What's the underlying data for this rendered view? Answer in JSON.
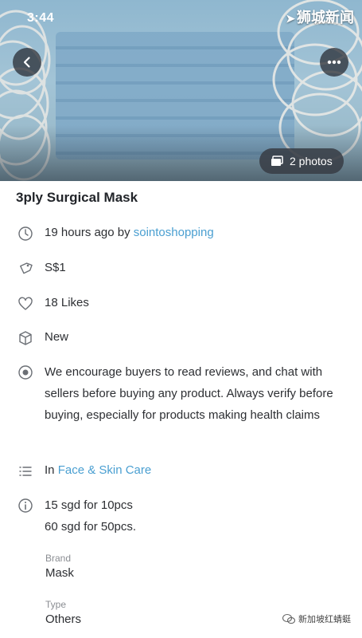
{
  "status_bar": {
    "time": "3:44"
  },
  "watermark_top": "狮城新闻",
  "gallery": {
    "photos_label": "2 photos",
    "back_icon": "back-arrow-icon",
    "more_icon": "more-dots-icon"
  },
  "listing": {
    "title": "3ply Surgical Mask",
    "posted_prefix": "19 hours ago by",
    "seller": "sointoshopping",
    "price": "S$1",
    "likes": "18 Likes",
    "condition": "New",
    "notice": "We encourage buyers to read reviews, and chat with sellers before buying any product. Always verify before buying, especially for products making health claims",
    "category_prefix": "In",
    "category": "Face & Skin Care",
    "description_line1": "15 sgd for 10pcs",
    "description_line2": "60 sgd for 50pcs.",
    "brand_label": "Brand",
    "brand_value": "Mask",
    "type_label": "Type",
    "type_value": "Others"
  },
  "watermark_bottom": "新加坡红蜻蜓",
  "colors": {
    "link": "#4a9fd1",
    "text": "#2d2f33",
    "muted": "#8a8d92"
  }
}
